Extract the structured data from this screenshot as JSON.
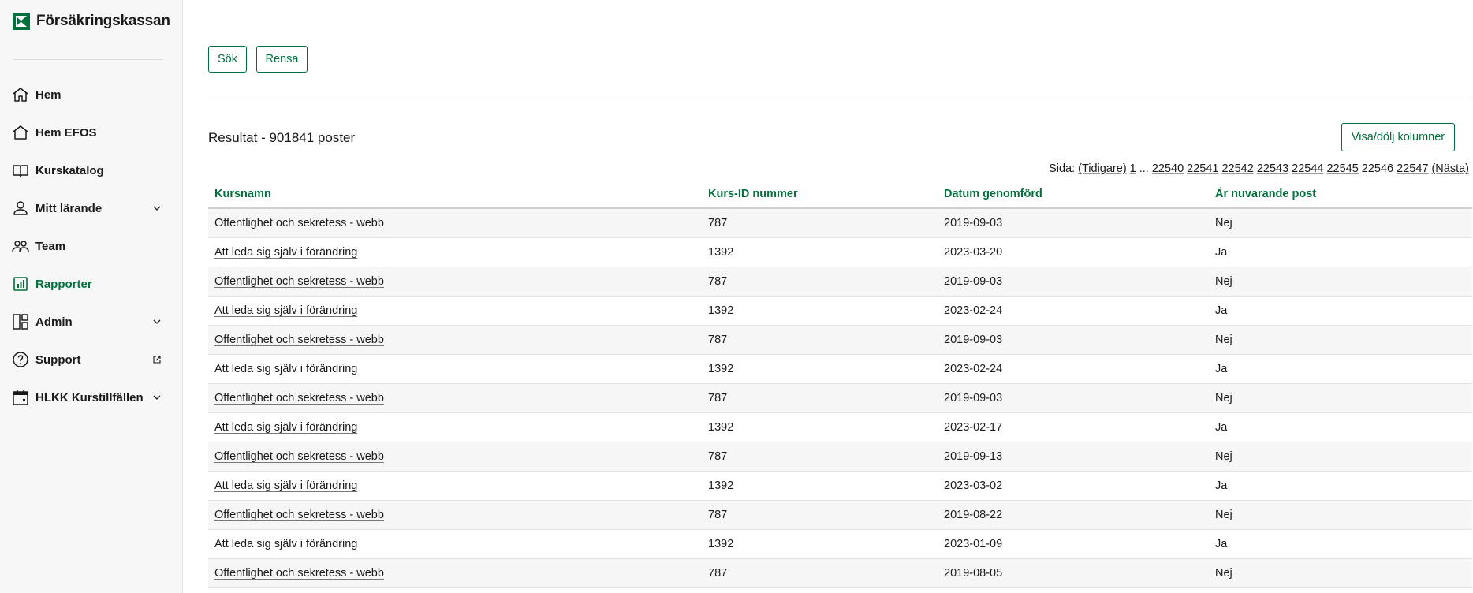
{
  "brand": {
    "name": "Försäkringskassan",
    "color": "#00703c"
  },
  "sidebar": {
    "items": [
      {
        "label": "Hem",
        "icon": "home-icon",
        "active": false,
        "trail": ""
      },
      {
        "label": "Hem EFOS",
        "icon": "home-outline-icon",
        "active": false,
        "trail": ""
      },
      {
        "label": "Kurskatalog",
        "icon": "book-icon",
        "active": false,
        "trail": ""
      },
      {
        "label": "Mitt lärande",
        "icon": "user-icon",
        "active": false,
        "trail": "chevron-down-icon"
      },
      {
        "label": "Team",
        "icon": "team-icon",
        "active": false,
        "trail": ""
      },
      {
        "label": "Rapporter",
        "icon": "report-chart-icon",
        "active": true,
        "trail": ""
      },
      {
        "label": "Admin",
        "icon": "admin-layout-icon",
        "active": false,
        "trail": "chevron-down-icon"
      },
      {
        "label": "Support",
        "icon": "question-icon",
        "active": false,
        "trail": "external-link-icon"
      },
      {
        "label": "HLKK Kurstillfällen",
        "icon": "calendar-icon",
        "active": false,
        "trail": "chevron-down-icon"
      }
    ]
  },
  "search": {
    "search_label": "Sök",
    "clear_label": "Rensa"
  },
  "results": {
    "title": "Resultat - 901841 poster",
    "columns_button": "Visa/dölj kolumner"
  },
  "pager": {
    "prefix": "Sida:",
    "prev": "(Tidigare)",
    "first": "1",
    "ellipsis": "...",
    "pages": [
      "22540",
      "22541",
      "22542",
      "22543",
      "22544",
      "22545",
      "22546",
      "22547"
    ],
    "current": "22546",
    "next": "(Nästa)"
  },
  "table": {
    "headers": [
      "Kursnamn",
      "Kurs-ID nummer",
      "Datum genomförd",
      "Är nuvarande post"
    ],
    "rows": [
      [
        "Offentlighet och sekretess - webb",
        "787",
        "2019-09-03",
        "Nej"
      ],
      [
        "Att leda sig själv i förändring",
        "1392",
        "2023-03-20",
        "Ja"
      ],
      [
        "Offentlighet och sekretess - webb",
        "787",
        "2019-09-03",
        "Nej"
      ],
      [
        "Att leda sig själv i förändring",
        "1392",
        "2023-02-24",
        "Ja"
      ],
      [
        "Offentlighet och sekretess - webb",
        "787",
        "2019-09-03",
        "Nej"
      ],
      [
        "Att leda sig själv i förändring",
        "1392",
        "2023-02-24",
        "Ja"
      ],
      [
        "Offentlighet och sekretess - webb",
        "787",
        "2019-09-03",
        "Nej"
      ],
      [
        "Att leda sig själv i förändring",
        "1392",
        "2023-02-17",
        "Ja"
      ],
      [
        "Offentlighet och sekretess - webb",
        "787",
        "2019-09-13",
        "Nej"
      ],
      [
        "Att leda sig själv i förändring",
        "1392",
        "2023-03-02",
        "Ja"
      ],
      [
        "Offentlighet och sekretess - webb",
        "787",
        "2019-08-22",
        "Nej"
      ],
      [
        "Att leda sig själv i förändring",
        "1392",
        "2023-01-09",
        "Ja"
      ],
      [
        "Offentlighet och sekretess - webb",
        "787",
        "2019-08-05",
        "Nej"
      ]
    ]
  }
}
